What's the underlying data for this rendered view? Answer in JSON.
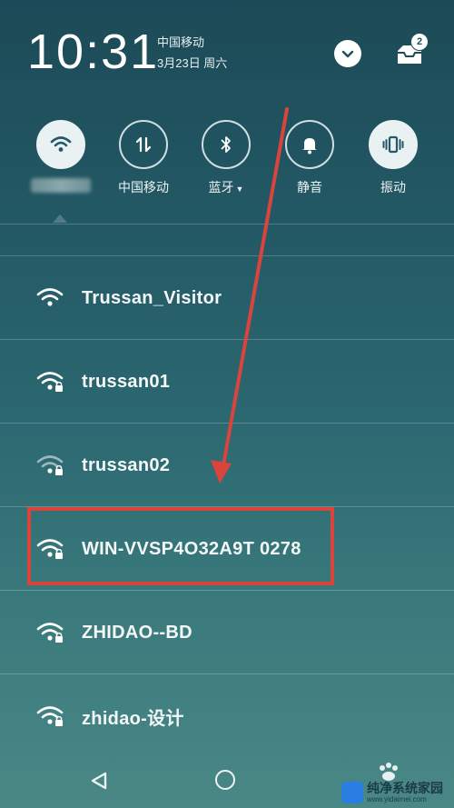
{
  "status": {
    "time": "10:31",
    "carrier": "中国移动",
    "date": "3月23日 周六",
    "notification_count": "2"
  },
  "quick_settings": [
    {
      "icon": "wifi-icon",
      "label": "",
      "active": true
    },
    {
      "icon": "mobile-data-icon",
      "label": "中国移动",
      "active": false
    },
    {
      "icon": "bluetooth-icon",
      "label": "蓝牙",
      "active": false
    },
    {
      "icon": "bell-icon",
      "label": "静音",
      "active": false
    },
    {
      "icon": "vibrate-icon",
      "label": "振动",
      "active": false
    }
  ],
  "wifi_networks": [
    {
      "name": "Trussan_Visitor",
      "secured": false
    },
    {
      "name": "trussan01",
      "secured": true
    },
    {
      "name": "trussan02",
      "secured": true
    },
    {
      "name": "WIN-VVSP4O32A9T 0278",
      "secured": true
    },
    {
      "name": "ZHIDAO--BD",
      "secured": true
    },
    {
      "name": "zhidao-设计",
      "secured": true
    }
  ],
  "annotation": {
    "highlight_color": "#d9443c"
  },
  "watermark": {
    "title": "纯净系统家园",
    "url": "www.yidaimei.com"
  }
}
